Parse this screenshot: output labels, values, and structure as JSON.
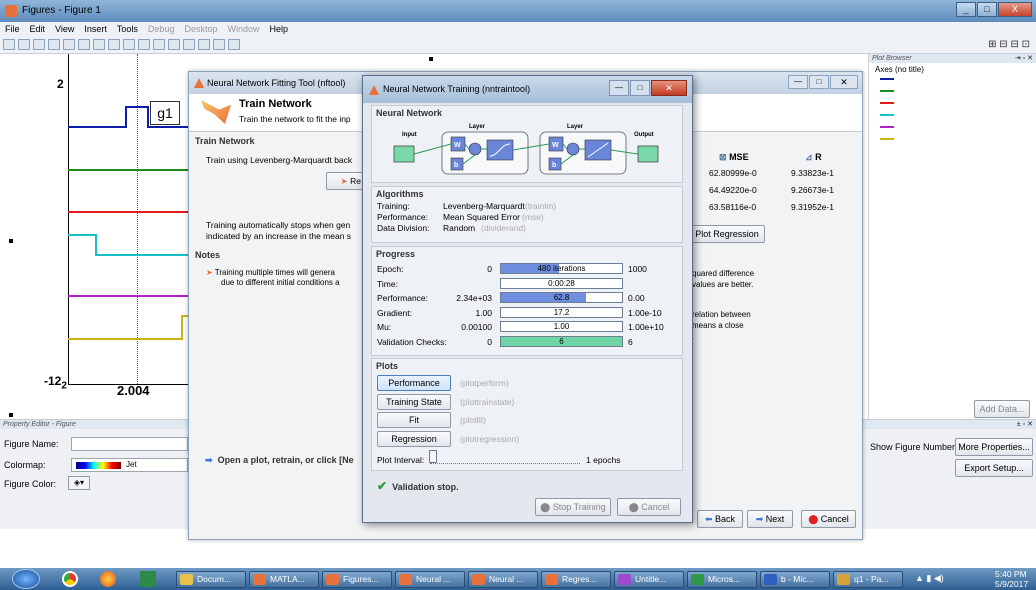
{
  "figure": {
    "title": "Figures - Figure 1",
    "menu": [
      {
        "label": "File",
        "dim": false
      },
      {
        "label": "Edit",
        "dim": false
      },
      {
        "label": "View",
        "dim": false
      },
      {
        "label": "Insert",
        "dim": false
      },
      {
        "label": "Tools",
        "dim": false
      },
      {
        "label": "Debug",
        "dim": true
      },
      {
        "label": "Desktop",
        "dim": true
      },
      {
        "label": "Window",
        "dim": true
      },
      {
        "label": "Help",
        "dim": false
      }
    ],
    "plot": {
      "ymax": "2",
      "ymin_base": "-12",
      "ymin_sub": "2",
      "xtick": "2.004",
      "marker_label": "g1",
      "trace_colors": [
        "#0b1ea8",
        "#1a8a1a",
        "#e21b1b",
        "#15c0c8",
        "#b421c8",
        "#c8b414"
      ]
    },
    "plot_browser": {
      "title": "Plot Browser",
      "axes_label": "Axes (no title)",
      "add_data_label": "Add Data..."
    },
    "property_editor": {
      "title": "Property Editor - Figure",
      "figure_name_label": "Figure Name:",
      "colormap_label": "Colormap:",
      "colormap_value": "Jet",
      "figure_color_label": "Figure Color:",
      "show_number_label": "Show Figure Number",
      "more_properties": "More Properties...",
      "export_setup": "Export Setup..."
    }
  },
  "nftool": {
    "title": "Neural Network Fitting Tool (nftool)",
    "heading": "Train Network",
    "subtitle": "Train the network to fit the inp",
    "train_section": "Train Network",
    "train_using": "Train using Levenberg-Marquardt back",
    "retrain_label": "Re",
    "auto_stop": "Training automatically stops when gen",
    "auto_stop2": "indicated by an increase in the mean s",
    "results": {
      "mse_header": "MSE",
      "r_header": "R",
      "rows": [
        {
          "mse": "62.80999e-0",
          "r": "9.33823e-1"
        },
        {
          "mse": "64.49220e-0",
          "r": "9.26673e-1"
        },
        {
          "mse": "63.58116e-0",
          "r": "9.31952e-1"
        }
      ]
    },
    "plot_regression": "Plot Regression",
    "notes_section": "Notes",
    "note1": "Training multiple times will genera",
    "note1b": "due to different initial conditions a",
    "note2a": "quared difference",
    "note2b": "values are better.",
    "note3a": "relation between",
    "note3b": "means a close",
    "note3c": ".",
    "bottom_hint": "Open a plot, retrain, or click [Ne",
    "back": "Back",
    "next": "Next",
    "cancel": "Cancel"
  },
  "nntraintool": {
    "title": "Neural Network Training (nntraintool)",
    "nn_section": "Neural Network",
    "layer1": "Layer",
    "layer2": "Layer",
    "input": "Input",
    "output": "Output",
    "w": "W",
    "b": "b",
    "algo_section": "Algorithms",
    "algorithms": [
      {
        "label": "Training:",
        "value": "Levenberg-Marquardt",
        "fn": "(trainlm)"
      },
      {
        "label": "Performance:",
        "value": "Mean Squared Error",
        "fn": "(mse)"
      },
      {
        "label": "Data Division:",
        "value": "Random",
        "fn": "(dividerand)"
      }
    ],
    "progress_section": "Progress",
    "progress": [
      {
        "label": "Epoch:",
        "start": "0",
        "current": "480 iterations",
        "end": "1000",
        "fill": 0.48,
        "color": "#6f8ee0"
      },
      {
        "label": "Time:",
        "start": "",
        "current": "0:00:28",
        "end": "",
        "fill": 0,
        "color": "#6f8ee0"
      },
      {
        "label": "Performance:",
        "start": "2.34e+03",
        "current": "62.8",
        "end": "0.00",
        "fill": 0.7,
        "color": "#6f8ee0"
      },
      {
        "label": "Gradient:",
        "start": "1.00",
        "current": "17.2",
        "end": "1.00e-10",
        "fill": 0,
        "color": "#6f8ee0"
      },
      {
        "label": "Mu:",
        "start": "0.00100",
        "current": "1.00",
        "end": "1.00e+10",
        "fill": 0,
        "color": "#6f8ee0"
      },
      {
        "label": "Validation Checks:",
        "start": "0",
        "current": "6",
        "end": "6",
        "fill": 1,
        "color": "#6fd4a4"
      }
    ],
    "plots_section": "Plots",
    "plots": [
      {
        "label": "Performance",
        "fn": "(plotperform)"
      },
      {
        "label": "Training State",
        "fn": "(plottrainstate)"
      },
      {
        "label": "Fit",
        "fn": "(plotfit)"
      },
      {
        "label": "Regression",
        "fn": "(plotregression)"
      }
    ],
    "plot_interval_label": "Plot Interval:",
    "plot_interval_value": "1 epochs",
    "status": "Validation stop.",
    "stop_training": "Stop Training",
    "cancel": "Cancel"
  },
  "taskbar": {
    "items": [
      {
        "label": "Docum...",
        "color": "#e6c24a"
      },
      {
        "label": "MATLA...",
        "color": "#e8703a"
      },
      {
        "label": "Figures...",
        "color": "#e8703a"
      },
      {
        "label": "Neural ...",
        "color": "#e8703a"
      },
      {
        "label": "Neural ...",
        "color": "#e8703a"
      },
      {
        "label": "Regres...",
        "color": "#e8703a"
      },
      {
        "label": "Untitle...",
        "color": "#a04ad0"
      },
      {
        "label": "Micros...",
        "color": "#2e9a48"
      },
      {
        "label": "b - Mic...",
        "color": "#2f5fbf"
      },
      {
        "label": "q1 - Pa...",
        "color": "#d6a53a"
      }
    ],
    "time": "5:40 PM",
    "date": "5/9/2017"
  }
}
